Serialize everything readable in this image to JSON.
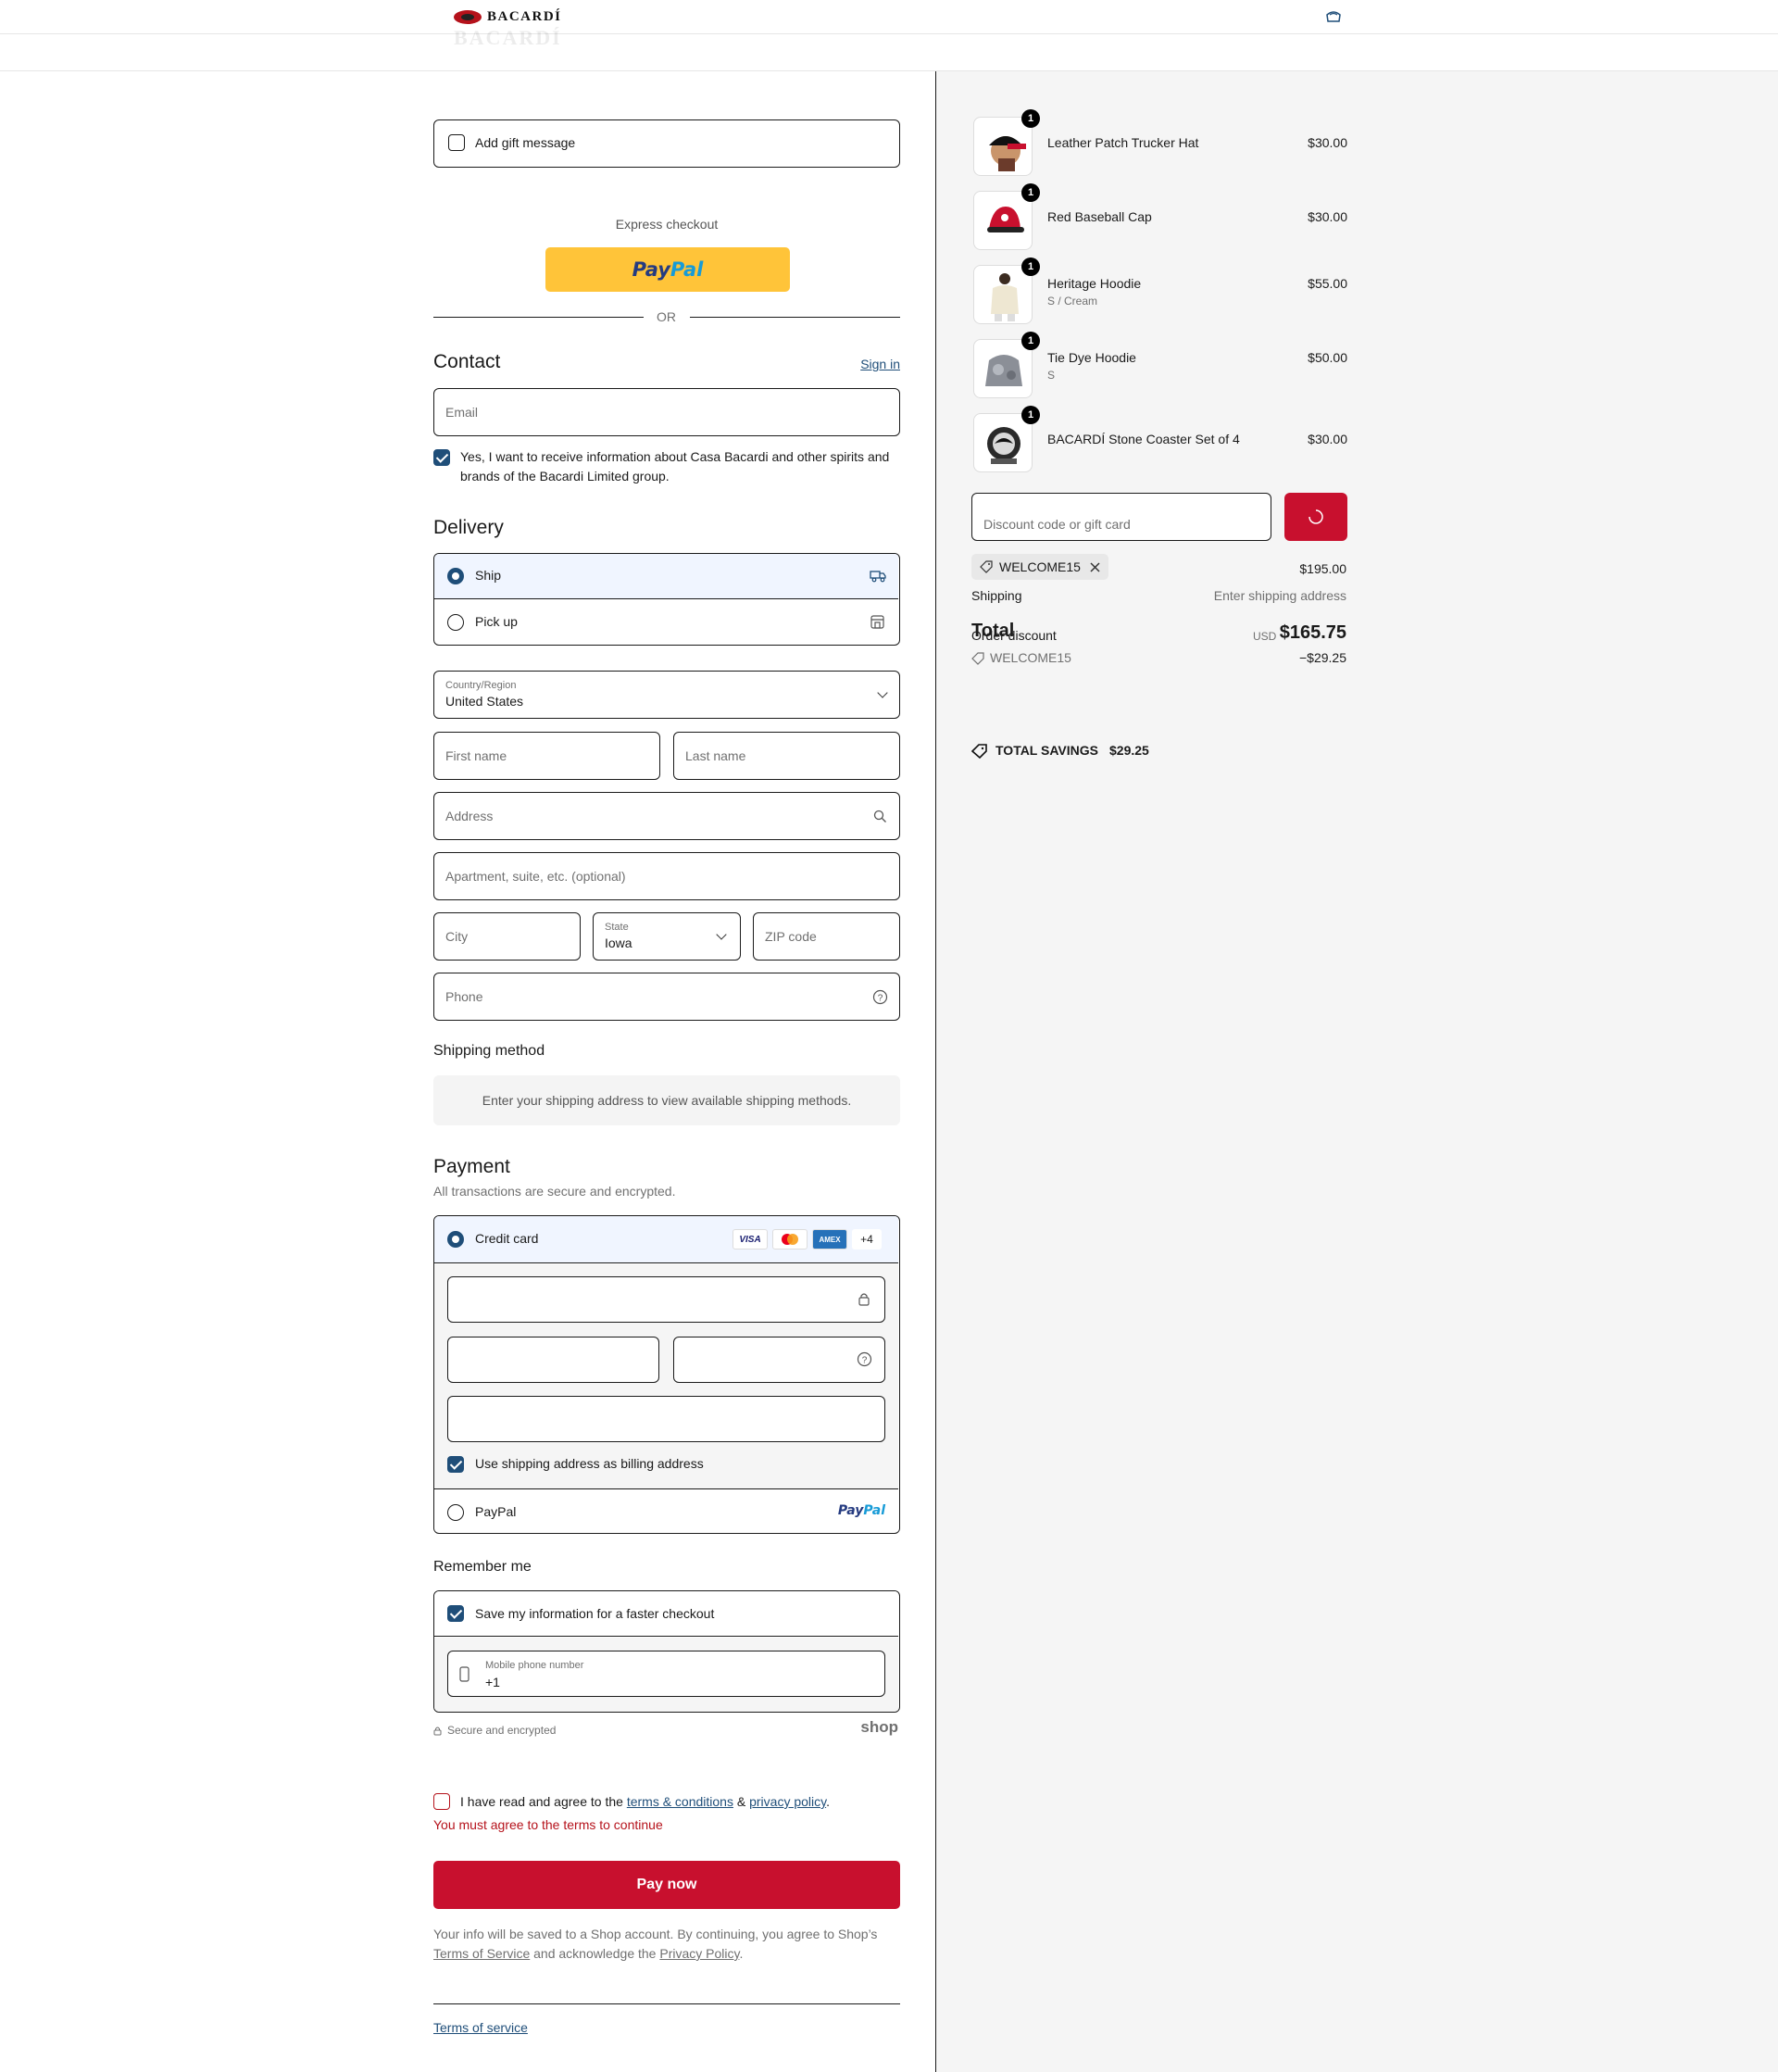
{
  "header": {
    "brand": "BACARDÍ",
    "brand_ghost": "BACARDÍ"
  },
  "gift": {
    "label": "Add gift message"
  },
  "express": {
    "title": "Express checkout",
    "paypal_a": "Pay",
    "paypal_b": "Pal",
    "or": "OR"
  },
  "contact": {
    "title": "Contact",
    "sign_in": "Sign in",
    "email_placeholder": "Email",
    "marketing_line1": "Yes, I want to receive information about Casa Bacardi and other spirits and",
    "marketing_line2": "brands of the Bacardi Limited group."
  },
  "delivery": {
    "title": "Delivery",
    "ship": "Ship",
    "pickup": "Pick up",
    "country_label": "Country/Region",
    "country_value": "United States",
    "first_name": "First name",
    "last_name": "Last name",
    "address": "Address",
    "apartment": "Apartment, suite, etc. (optional)",
    "city": "City",
    "state_label": "State",
    "state_value": "Iowa",
    "zip": "ZIP code",
    "phone": "Phone"
  },
  "shipping_method": {
    "title": "Shipping method",
    "note": "Enter your shipping address to view available shipping methods."
  },
  "payment": {
    "title": "Payment",
    "subtitle": "All transactions are secure and encrypted.",
    "credit_card": "Credit card",
    "visa": "VISA",
    "amex": "AMEX",
    "more": "+4",
    "billing_same": "Use shipping address as billing address",
    "paypal": "PayPal",
    "paypal_a": "Pay",
    "paypal_b": "Pal"
  },
  "remember": {
    "title": "Remember me",
    "save": "Save my information for a faster checkout",
    "mobile_label": "Mobile phone number",
    "mobile_value": "+1",
    "secure": "Secure and encrypted",
    "shop": "shop"
  },
  "terms": {
    "prefix": "I have read and agree to the ",
    "terms_link": "terms & conditions",
    "amp": " & ",
    "privacy_link": "privacy policy",
    "suffix": ".",
    "error": "You must agree to the terms to continue"
  },
  "pay_now": "Pay now",
  "shop_notice": {
    "line1": "Your info will be saved to a Shop account. By continuing, you agree to Shop’s",
    "tos": "Terms of Service",
    "mid": " and acknowledge the ",
    "privacy": "Privacy Policy",
    "end": "."
  },
  "footer": {
    "terms_of_service": "Terms of service"
  },
  "summary": {
    "items": [
      {
        "name": "Leather Patch Trucker Hat",
        "variant": "",
        "price": "$30.00",
        "qty": "1"
      },
      {
        "name": "Red Baseball Cap",
        "variant": "",
        "price": "$30.00",
        "qty": "1"
      },
      {
        "name": "Heritage Hoodie",
        "variant": "S / Cream",
        "price": "$55.00",
        "qty": "1"
      },
      {
        "name": "Tie Dye Hoodie",
        "variant": "S",
        "price": "$50.00",
        "qty": "1"
      },
      {
        "name": "BACARDÍ Stone Coaster Set of 4",
        "variant": "",
        "price": "$30.00",
        "qty": "1"
      }
    ],
    "discount_placeholder": "Discount code or gift card",
    "discount_tag": "WELCOME15",
    "subtotal_value": "$195.00",
    "shipping_label": "Shipping",
    "shipping_value": "Enter shipping address",
    "total_label": "Total",
    "order_discount_label": "Order discount",
    "currency": "USD",
    "total_value": "$165.75",
    "discount_code": "WELCOME15",
    "discount_value": "−$29.25",
    "savings_label": "TOTAL SAVINGS",
    "savings_value": "$29.25"
  },
  "colors": {
    "accent": "#1f4e79",
    "brand_red": "#c8102e",
    "paypal_yellow": "#ffc439"
  }
}
